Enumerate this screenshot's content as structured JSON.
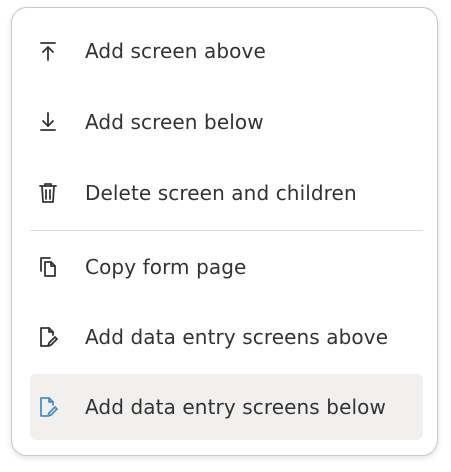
{
  "menu": {
    "items": [
      {
        "label": "Add screen above",
        "icon": "arrow-up-to-line-icon"
      },
      {
        "label": "Add screen below",
        "icon": "arrow-down-to-line-icon"
      },
      {
        "label": "Delete screen and children",
        "icon": "trash-icon"
      },
      {
        "label": "Copy form page",
        "icon": "copy-icon"
      },
      {
        "label": "Add data entry screens above",
        "icon": "file-edit-icon"
      },
      {
        "label": "Add data entry screens below",
        "icon": "file-edit-icon"
      }
    ],
    "active_index": 5,
    "colors": {
      "text": "#333333",
      "icon": "#333333",
      "active_icon": "#4a90c2",
      "active_background": "#f1f0ef",
      "divider": "#dcdcdc",
      "border": "#c9c9c9"
    }
  }
}
